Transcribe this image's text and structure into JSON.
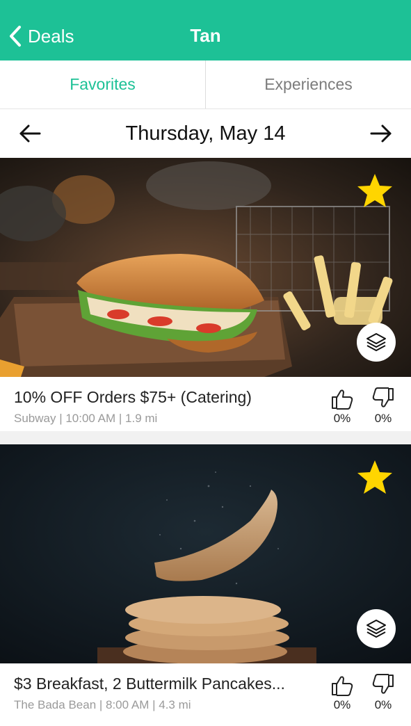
{
  "header": {
    "back_label": "Deals",
    "title": "Tan"
  },
  "tabs": [
    {
      "label": "Favorites",
      "active": true
    },
    {
      "label": "Experiences",
      "active": false
    }
  ],
  "date_nav": {
    "label": "Thursday, May 14"
  },
  "colors": {
    "brand": "#1dc196",
    "star": "#ffd500",
    "text": "#222222",
    "muted": "#9a9a9a"
  },
  "deals": [
    {
      "title": "10% OFF Orders $75+ (Catering)",
      "meta": "Subway | 10:00 AM | 1.9 mi",
      "likes": "0%",
      "dislikes": "0%",
      "favorited": true,
      "image": "sandwich-photo"
    },
    {
      "title": "$3 Breakfast, 2 Buttermilk Pancakes...",
      "meta": "The Bada Bean | 8:00 AM | 4.3 mi",
      "likes": "0%",
      "dislikes": "0%",
      "favorited": true,
      "image": "pancakes-photo"
    }
  ]
}
